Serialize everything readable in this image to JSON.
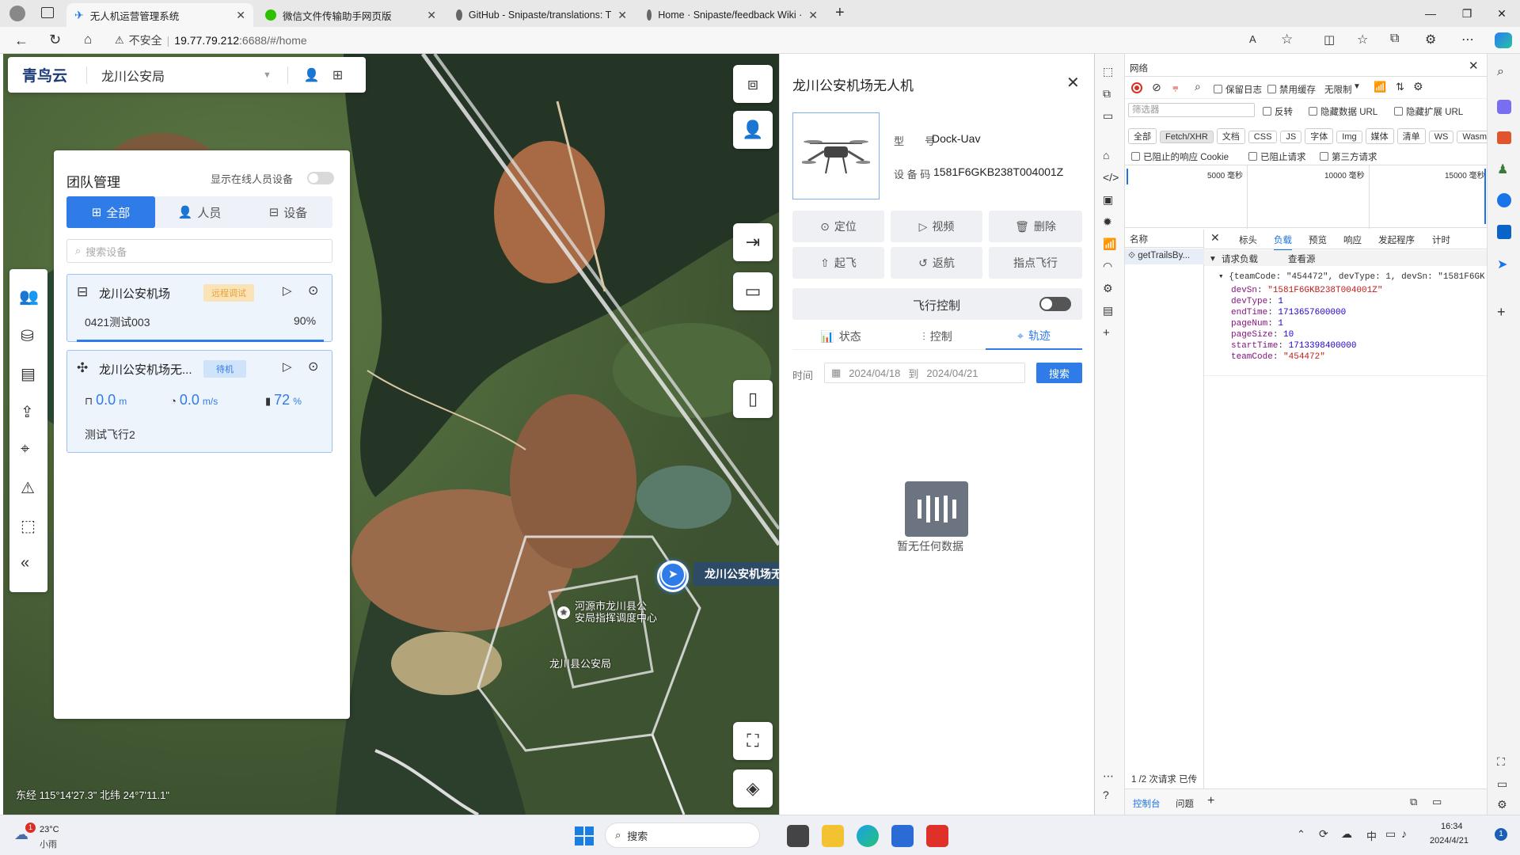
{
  "browser": {
    "tabs": [
      {
        "title": "无人机运营管理系统",
        "active": true
      },
      {
        "title": "微信文件传输助手网页版",
        "active": false
      },
      {
        "title": "GitHub - Snipaste/translations: T",
        "active": false
      },
      {
        "title": "Home · Snipaste/feedback Wiki ·",
        "active": false
      }
    ],
    "security_label": "不安全",
    "url_host": "19.77.79.212",
    "url_rest": ":6688/#/home"
  },
  "app": {
    "logo": "青鸟云",
    "org": "龙川公安局"
  },
  "team": {
    "title": "团队管理",
    "online_toggle_label": "显示在线人员设备",
    "tabs": [
      "全部",
      "人员",
      "设备"
    ],
    "search_placeholder": "搜索设备",
    "device1": {
      "name": "龙川公安机场",
      "badge": "远程调试",
      "task": "0421测试003",
      "progress": "90%"
    },
    "device2": {
      "name": "龙川公安机场无...",
      "badge": "待机",
      "height": "0.0",
      "height_unit": "m",
      "speed": "0.0",
      "speed_unit": "m/s",
      "battery": "72",
      "battery_unit": "%",
      "task": "测试飞行2"
    }
  },
  "map": {
    "label_place": "河源市龙川县公安局指挥调度中心",
    "label_place_display": "河源市龙川县公\n安局指挥调度中心",
    "label_bureau": "龙川县公安局",
    "drone_callout": "龙川公安机场无",
    "coords": "东经 115°14'27.3\" 北纬 24°7'11.1\""
  },
  "panel": {
    "title": "龙川公安机场无人机",
    "model_label": "型　　号",
    "model": "Dock-Uav",
    "code_label": "设 备 码",
    "code": "1581F6GKB238T004001Z",
    "actions": [
      "定位",
      "视频",
      "删除",
      "起飞",
      "返航",
      "指点飞行"
    ],
    "flight_control": "飞行控制",
    "subtabs": [
      "状态",
      "控制",
      "轨迹"
    ],
    "time_label": "时间",
    "date_from": "2024/04/18",
    "date_sep": "到",
    "date_to": "2024/04/21",
    "search_button": "搜索",
    "empty": "暂无任何数据"
  },
  "devtools": {
    "title": "网络",
    "preserve_log": "保留日志",
    "disable_cache": "禁用缓存",
    "throttle": "无限制",
    "filter_placeholder": "筛选器",
    "invert": "反转",
    "hide_data_url": "隐藏数据 URL",
    "hide_ext_url": "隐藏扩展 URL",
    "types": [
      "全部",
      "Fetch/XHR",
      "文档",
      "CSS",
      "JS",
      "字体",
      "Img",
      "媒体",
      "清单",
      "WS",
      "Wasm"
    ],
    "blocked_cookies": "已阻止的响应 Cookie",
    "blocked_requests": "已阻止请求",
    "third_party": "第三方请求",
    "timeline": [
      "5000 毫秒",
      "10000 毫秒",
      "15000 毫秒"
    ],
    "name_col": "名称",
    "request_name": "getTrailsBy...",
    "detail_tabs": [
      "标头",
      "负载",
      "预览",
      "响应",
      "发起程序",
      "计时"
    ],
    "payload_title": "请求负载",
    "view_source": "查看源",
    "payload_summary": "{teamCode: \"454472\", devType: 1, devSn: \"1581F6GKB238T",
    "payload": [
      {
        "k": "devSn",
        "v": "\"1581F6GKB238T004001Z\""
      },
      {
        "k": "devType",
        "v": "1"
      },
      {
        "k": "endTime",
        "v": "1713657600000"
      },
      {
        "k": "pageNum",
        "v": "1"
      },
      {
        "k": "pageSize",
        "v": "10"
      },
      {
        "k": "startTime",
        "v": "1713398400000"
      },
      {
        "k": "teamCode",
        "v": "\"454472\""
      }
    ],
    "status": "1 /2 次请求  已传",
    "console_tab": "控制台",
    "issues_tab": "问题"
  },
  "taskbar": {
    "temp": "23°C",
    "weather": "小雨",
    "weather_badge": "1",
    "search": "搜索",
    "ime": "中",
    "time": "16:34",
    "date": "2024/4/21",
    "notif": "1"
  }
}
